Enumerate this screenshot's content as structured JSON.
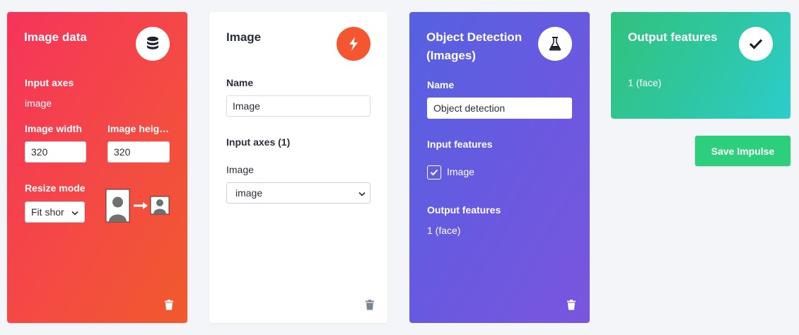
{
  "colors": {
    "image_data_card": "#f44a44",
    "object_detection_card": "#6a59e0",
    "output_features_card": "#2ec7a8",
    "processing_badge": "#f4562f",
    "save_button": "#2ecf7c"
  },
  "cards": {
    "image_data": {
      "title": "Image data",
      "icon": "database-icon",
      "input_axes_label": "Input axes",
      "input_axes_value": "image",
      "image_width_label": "Image width",
      "image_width_value": "320",
      "image_height_label": "Image heig…",
      "image_height_value": "320",
      "resize_mode_label": "Resize mode",
      "resize_mode_value": "Fit shor"
    },
    "image": {
      "title": "Image",
      "icon": "lightning-bolt-icon",
      "name_label": "Name",
      "name_value": "Image",
      "input_axes_label": "Input axes (1)",
      "axis_label": "Image",
      "axis_value": "image"
    },
    "object_detection": {
      "title_line1": "Object Detection",
      "title_line2": "(Images)",
      "icon": "flask-icon",
      "name_label": "Name",
      "name_value": "Object detection",
      "input_features_label": "Input features",
      "feature_checkbox_label": "Image",
      "feature_checked": true,
      "output_features_label": "Output features",
      "output_features_value": "1 (face)"
    },
    "output_features": {
      "title": "Output features",
      "icon": "checkmark-icon",
      "value": "1 (face)"
    }
  },
  "actions": {
    "save_label": "Save Impulse"
  }
}
